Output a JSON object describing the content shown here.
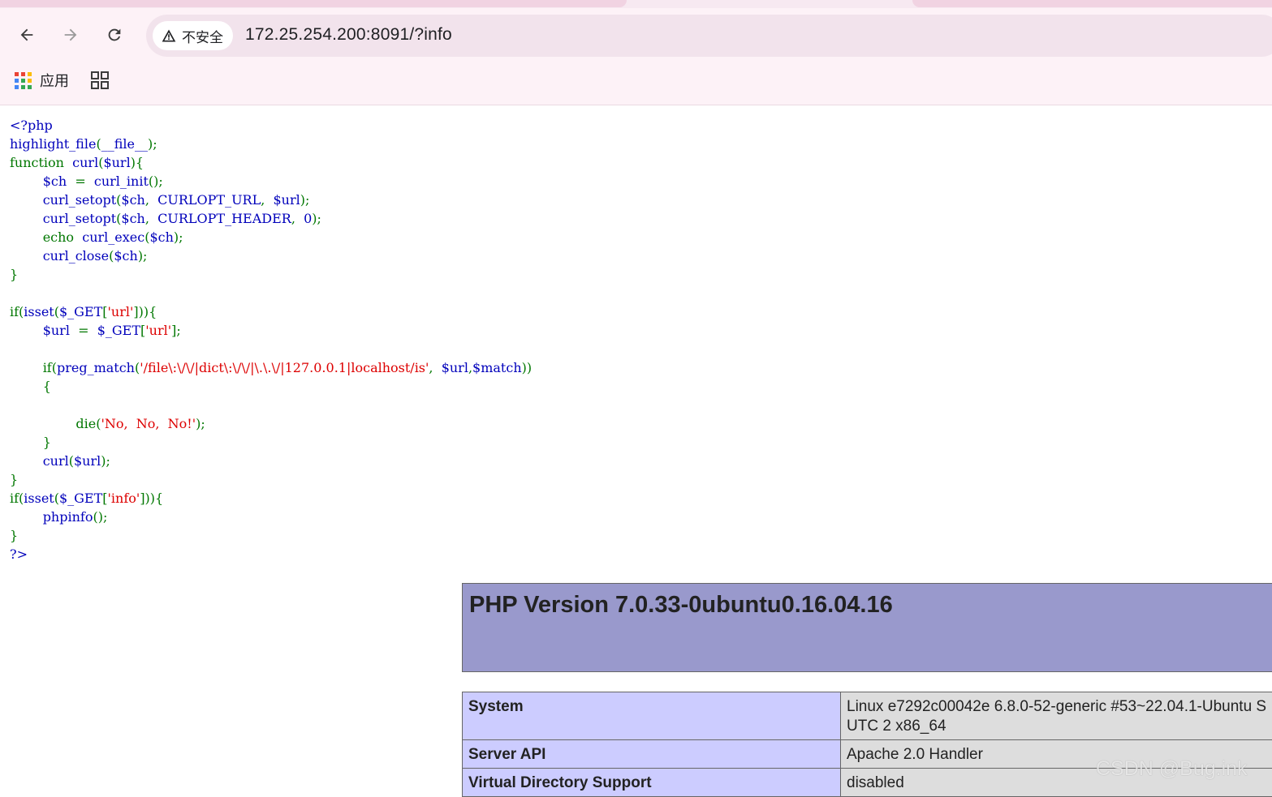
{
  "browser": {
    "security_label": "不安全",
    "url": "172.25.254.200:8091/?info",
    "bookmarks": {
      "apps_label": "应用"
    }
  },
  "source_code": [
    [
      [
        "d",
        "<?php"
      ]
    ],
    [
      [
        "d",
        "highlight_file"
      ],
      [
        "k",
        "("
      ],
      [
        "d",
        "__file__"
      ],
      [
        "k",
        ");"
      ]
    ],
    [
      [
        "k",
        "function  "
      ],
      [
        "d",
        "curl"
      ],
      [
        "k",
        "("
      ],
      [
        "d",
        "$url"
      ],
      [
        "k",
        "){"
      ]
    ],
    [
      [
        "k",
        "        "
      ],
      [
        "d",
        "$ch  "
      ],
      [
        "k",
        "=  "
      ],
      [
        "d",
        "curl_init"
      ],
      [
        "k",
        "();"
      ]
    ],
    [
      [
        "k",
        "        "
      ],
      [
        "d",
        "curl_setopt"
      ],
      [
        "k",
        "("
      ],
      [
        "d",
        "$ch"
      ],
      [
        "k",
        ",  "
      ],
      [
        "d",
        "CURLOPT_URL"
      ],
      [
        "k",
        ",  "
      ],
      [
        "d",
        "$url"
      ],
      [
        "k",
        ");"
      ]
    ],
    [
      [
        "k",
        "        "
      ],
      [
        "d",
        "curl_setopt"
      ],
      [
        "k",
        "("
      ],
      [
        "d",
        "$ch"
      ],
      [
        "k",
        ",  "
      ],
      [
        "d",
        "CURLOPT_HEADER"
      ],
      [
        "k",
        ",  "
      ],
      [
        "d",
        "0"
      ],
      [
        "k",
        ");"
      ]
    ],
    [
      [
        "k",
        "        echo  "
      ],
      [
        "d",
        "curl_exec"
      ],
      [
        "k",
        "("
      ],
      [
        "d",
        "$ch"
      ],
      [
        "k",
        ");"
      ]
    ],
    [
      [
        "k",
        "        "
      ],
      [
        "d",
        "curl_close"
      ],
      [
        "k",
        "("
      ],
      [
        "d",
        "$ch"
      ],
      [
        "k",
        ");"
      ]
    ],
    [
      [
        "k",
        "}"
      ]
    ],
    [
      [
        "k",
        ""
      ]
    ],
    [
      [
        "k",
        "if("
      ],
      [
        "d",
        "isset"
      ],
      [
        "k",
        "("
      ],
      [
        "d",
        "$_GET"
      ],
      [
        "k",
        "["
      ],
      [
        "s",
        "'url'"
      ],
      [
        "k",
        "])){"
      ]
    ],
    [
      [
        "k",
        "        "
      ],
      [
        "d",
        "$url  "
      ],
      [
        "k",
        "=  "
      ],
      [
        "d",
        "$_GET"
      ],
      [
        "k",
        "["
      ],
      [
        "s",
        "'url'"
      ],
      [
        "k",
        "];"
      ]
    ],
    [
      [
        "k",
        ""
      ]
    ],
    [
      [
        "k",
        "        if("
      ],
      [
        "d",
        "preg_match"
      ],
      [
        "k",
        "("
      ],
      [
        "s",
        "'/file\\:\\/\\/|dict\\:\\/\\/|\\.\\.\\/|127.0.0.1|localhost/is'"
      ],
      [
        "k",
        ",  "
      ],
      [
        "d",
        "$url"
      ],
      [
        "k",
        ","
      ],
      [
        "d",
        "$match"
      ],
      [
        "k",
        "))"
      ]
    ],
    [
      [
        "k",
        "        {"
      ]
    ],
    [
      [
        "k",
        ""
      ]
    ],
    [
      [
        "k",
        "                die("
      ],
      [
        "s",
        "'No,  No,  No!'"
      ],
      [
        "k",
        ");"
      ]
    ],
    [
      [
        "k",
        "        }"
      ]
    ],
    [
      [
        "k",
        "        "
      ],
      [
        "d",
        "curl"
      ],
      [
        "k",
        "("
      ],
      [
        "d",
        "$url"
      ],
      [
        "k",
        ");"
      ]
    ],
    [
      [
        "k",
        "}"
      ]
    ],
    [
      [
        "k",
        "if("
      ],
      [
        "d",
        "isset"
      ],
      [
        "k",
        "("
      ],
      [
        "d",
        "$_GET"
      ],
      [
        "k",
        "["
      ],
      [
        "s",
        "'info'"
      ],
      [
        "k",
        "])){"
      ]
    ],
    [
      [
        "k",
        "        "
      ],
      [
        "d",
        "phpinfo"
      ],
      [
        "k",
        "();"
      ]
    ],
    [
      [
        "k",
        "}"
      ]
    ],
    [
      [
        "d",
        "?>"
      ]
    ]
  ],
  "phpinfo": {
    "version_title": "PHP Version 7.0.33-0ubuntu0.16.04.16",
    "rows": [
      {
        "key": "System",
        "value": "Linux e7292c00042e 6.8.0-52-generic #53~22.04.1-Ubuntu S\nUTC 2 x86_64"
      },
      {
        "key": "Server API",
        "value": "Apache 2.0 Handler"
      },
      {
        "key": "Virtual Directory Support",
        "value": "disabled"
      }
    ]
  },
  "watermark": "CSDN @Bug.ink",
  "colors": {
    "php_keyword": "#007700",
    "php_default": "#0000bb",
    "php_string": "#dd0000",
    "phpinfo_header": "#9999cc",
    "phpinfo_key": "#ccccff",
    "phpinfo_value": "#dddddd"
  },
  "icons": [
    "back-arrow-icon",
    "forward-arrow-icon",
    "reload-icon",
    "warning-triangle-icon",
    "apps-grid-icon",
    "tab-grid-icon"
  ]
}
